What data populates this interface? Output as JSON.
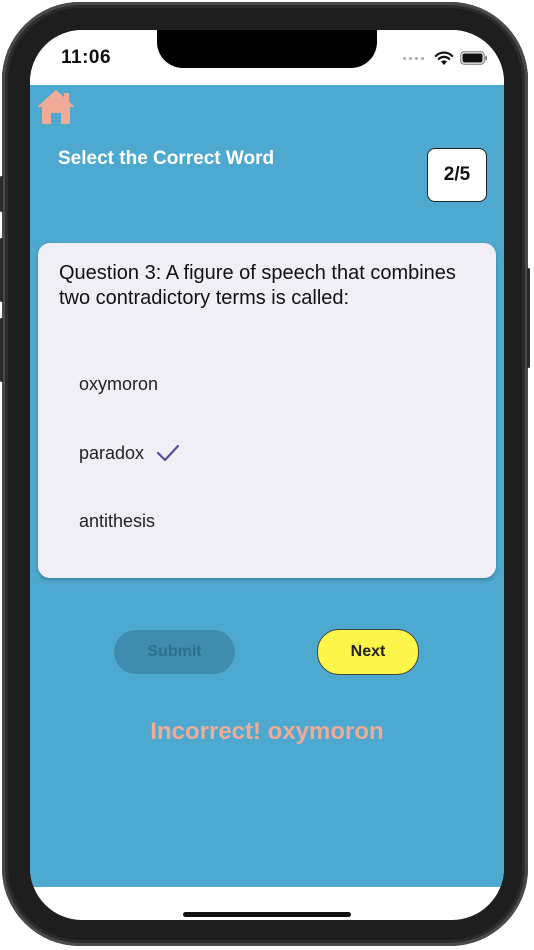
{
  "status_bar": {
    "time": "11:06",
    "icons": [
      "signal-dots-icon",
      "wifi-icon",
      "battery-icon"
    ]
  },
  "header": {
    "home_icon": "home-icon",
    "title": "Select the Correct Word",
    "progress": "2/5"
  },
  "question": {
    "text": "Question 3: A figure of speech that combines two contradictory terms is called:",
    "options": [
      {
        "label": "oxymoron",
        "selected": false
      },
      {
        "label": "paradox",
        "selected": true,
        "icon": "check-icon"
      },
      {
        "label": "antithesis",
        "selected": false
      }
    ]
  },
  "actions": {
    "submit_label": "Submit",
    "submit_enabled": false,
    "next_label": "Next"
  },
  "feedback": {
    "text": "Incorrect! oxymoron"
  },
  "colors": {
    "app_background": "#4ea9d0",
    "card_background": "#f1eff6",
    "home_icon": "#f0ab98",
    "check": "#5b4a9e",
    "next_button": "#fdf54a",
    "submit_disabled": "#3f8cae",
    "feedback_text": "#f0ab98"
  }
}
